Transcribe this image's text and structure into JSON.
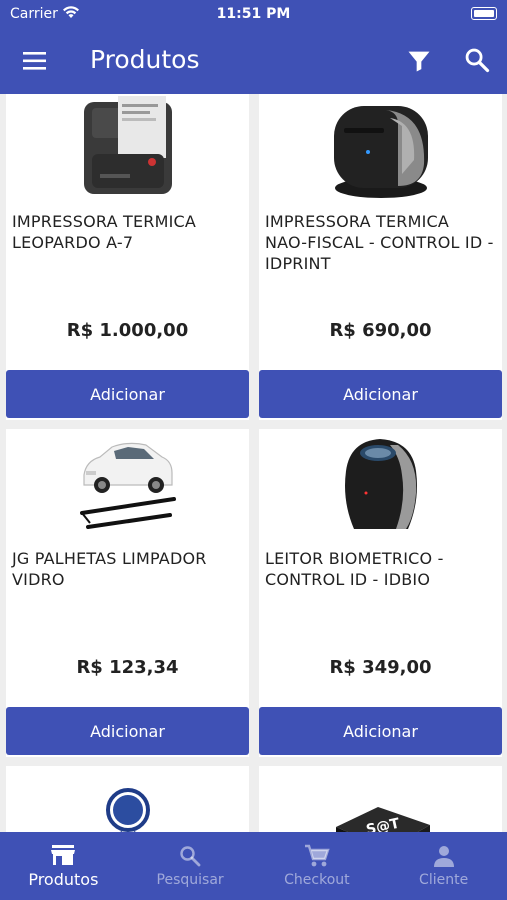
{
  "status": {
    "carrier": "Carrier",
    "time": "11:51 PM"
  },
  "appbar": {
    "title": "Produtos"
  },
  "products": [
    {
      "name": "IMPRESSORA TERMICA LEOPARDO A-7",
      "price": "R$ 1.000,00",
      "button": "Adicionar"
    },
    {
      "name": "IMPRESSORA TERMICA NAO-FISCAL - CONTROL ID - IDPRINT",
      "price": "R$ 690,00",
      "button": "Adicionar"
    },
    {
      "name": "JG PALHETAS LIMPADOR VIDRO",
      "price": "R$ 123,34",
      "button": "Adicionar"
    },
    {
      "name": "LEITOR BIOMETRICO - CONTROL ID - IDBIO",
      "price": "R$ 349,00",
      "button": "Adicionar"
    }
  ],
  "partial_products": [
    {
      "label": ""
    },
    {
      "logo_text": "S@T"
    }
  ],
  "tabs": [
    {
      "label": "Produtos",
      "icon": "store-icon",
      "active": true
    },
    {
      "label": "Pesquisar",
      "icon": "search-icon",
      "active": false
    },
    {
      "label": "Checkout",
      "icon": "cart-icon",
      "active": false
    },
    {
      "label": "Cliente",
      "icon": "person-icon",
      "active": false
    }
  ],
  "colors": {
    "primary": "#3f51b5",
    "background": "#eeeeee",
    "card": "#ffffff"
  }
}
